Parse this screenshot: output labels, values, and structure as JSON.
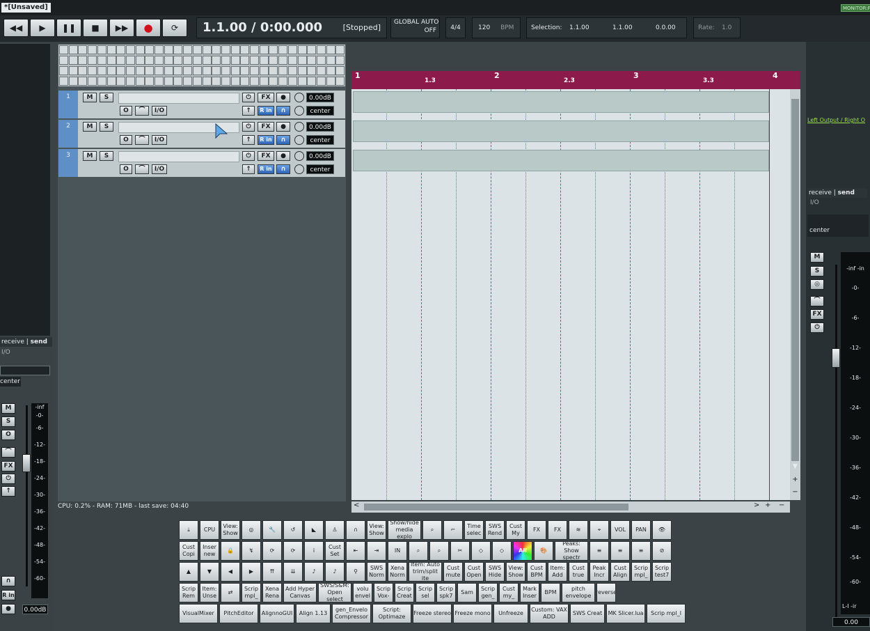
{
  "window": {
    "title": "*[Unsaved]",
    "monitor": "MONITOR:F"
  },
  "transport": {
    "time": "1.1.00 / 0:00.000",
    "state": "[Stopped]",
    "global_auto": "GLOBAL AUTO",
    "global_auto_state": "OFF",
    "time_sig": "4/4",
    "tempo": "120",
    "bpm_label": "BPM",
    "selection_label": "Selection:",
    "sel_start": "1.1.00",
    "sel_end": "1.1.00",
    "sel_len": "0.0.00",
    "rate_label": "Rate:",
    "rate": "1.0"
  },
  "tracks": [
    {
      "num": "1",
      "vol": "0.00dB",
      "pan": "center"
    },
    {
      "num": "2",
      "vol": "0.00dB",
      "pan": "center"
    },
    {
      "num": "3",
      "vol": "0.00dB",
      "pan": "center"
    }
  ],
  "track_buttons": {
    "mute": "M",
    "solo": "S",
    "fx": "FX",
    "io": "I/O",
    "rin": "R in"
  },
  "ruler": [
    "1",
    "1.3",
    "2",
    "2.3",
    "3",
    "3.3",
    "4"
  ],
  "status": "CPU: 0.2% - RAM: 71MB - last save: 04:40",
  "left_mixer": {
    "receive": "receive",
    "send": "send",
    "io": "I/O",
    "pan": "center",
    "vol": "0.00dB",
    "scale": [
      "-inf",
      "-0-",
      "-6-",
      "-12-",
      "-18-",
      "-24-",
      "-30-",
      "-36-",
      "-42-",
      "-48-",
      "-54-",
      "-60-"
    ],
    "buttons": [
      "M",
      "S",
      "O",
      "FX"
    ],
    "rin": "R in"
  },
  "right_mixer": {
    "output": "Left Output / Right O",
    "receive": "receive",
    "send": "send",
    "io": "I/O",
    "pan": "center",
    "buttons": [
      "M",
      "S",
      "FX"
    ],
    "scale": [
      "-inf  -in",
      "-0-",
      "-6-",
      "-12-",
      "-18-",
      "-24-",
      "-30-",
      "-36-",
      "-42-",
      "-48-",
      "-54-",
      "-60-"
    ],
    "lr": "L-I  -ir",
    "vol": "0.00"
  },
  "toolbar": {
    "row1": [
      "⤓",
      "CPU",
      "View: Show",
      "◎",
      "🔧",
      "↺",
      "◣",
      "♙",
      "∩",
      "View: Show",
      "Show/hide media explo",
      "⌕",
      "⌐",
      "Time selec",
      "SWS Rend",
      "Cust My",
      "FX",
      "FX",
      "≋",
      "⌖",
      "VOL",
      "PAN",
      "👁"
    ],
    "row2": [
      "Cust Copi",
      "Inser new",
      "🔒",
      "↯",
      "⟳",
      "⟳",
      "i",
      "Cust Set",
      "⇤",
      "⇥",
      "IN",
      "⌕",
      "⌕",
      "✂",
      "◇",
      "◇",
      "All",
      "🎨",
      "Peaks: Show spectr",
      "≡",
      "≡",
      "≡",
      "⊘"
    ],
    "row3": [
      "▲",
      "▼",
      "◀",
      "▶",
      "⇈",
      "⇊",
      "♪",
      "♪",
      "⚲",
      "SWS Norm",
      "Xena Norm",
      "Item: Auto trim/split ite",
      "Cust mute",
      "Cust Open",
      "SWS Hide",
      "View: Show",
      "Cust BPM",
      "Item: Add",
      "Cust true",
      "Peak Incr",
      "Cust Align",
      "Scrip mpl_",
      "Scrip test7"
    ],
    "row4": [
      "Scrip Rem",
      "Item: Unse",
      "⇄",
      "Scrip mpl_",
      "Xena Rena",
      "Add Hyper Canvas",
      "SWS/S&M: Open select",
      "volu envel",
      "Scrip Vox-",
      "Scrip Creat",
      "Scrip sel",
      "Scrip spk7",
      "Sam",
      "Scrip gen_",
      "Cust my_",
      "Mark Inser",
      "BPM",
      "pitch envelope",
      "reverse"
    ],
    "row5": [
      "VisualMixer",
      "PitchEditor",
      "AlignnoGUI",
      "Align 1.13",
      "gen_Envelo Compressor",
      "Script: Optimaze",
      "Freeze stereo",
      "Freeze mono",
      "Unfreeze",
      "Custom: VAX ADD",
      "SWS Creat",
      "MK Slicer.lua",
      "Scrip mpl_l"
    ]
  }
}
